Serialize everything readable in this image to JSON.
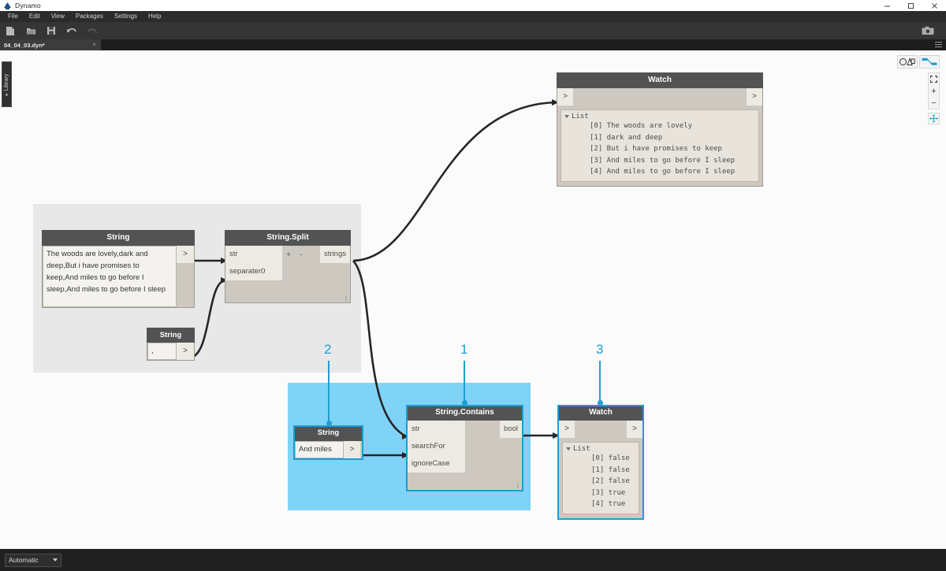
{
  "window": {
    "app_title": "Dynamo",
    "logo_icon": "dynamo-logo-icon",
    "minimize_label": "–",
    "maximize_label": "□",
    "close_label": "✕"
  },
  "menu": {
    "items": [
      {
        "label": "File"
      },
      {
        "label": "Edit"
      },
      {
        "label": "View"
      },
      {
        "label": "Packages"
      },
      {
        "label": "Settings"
      },
      {
        "label": "Help"
      }
    ]
  },
  "toolbar": {
    "buttons": [
      {
        "name": "new-file-icon"
      },
      {
        "name": "open-file-icon"
      },
      {
        "name": "save-file-icon"
      },
      {
        "name": "undo-icon"
      },
      {
        "name": "redo-icon"
      }
    ],
    "screenshot_icon": "camera-icon"
  },
  "tabs": {
    "active": {
      "label": "04_04_03.dyn*",
      "close_label": "×"
    },
    "menu_icon": "hamburger-icon"
  },
  "library": {
    "label": "Library",
    "arrow": "▸"
  },
  "canvas_controls": {
    "geometry_toggle_icon": "geometry-view-icon",
    "graph_toggle_icon": "graph-view-icon",
    "zoom_fit_label": "⤡",
    "zoom_in_label": "+",
    "zoom_out_label": "−",
    "pan_icon": "pan-icon"
  },
  "nodes": {
    "watch_top": {
      "title": "Watch",
      "in_port": ">",
      "out_port": ">",
      "list_label": "List",
      "items": [
        "[0] The woods are lovely",
        "[1] dark and deep",
        "[2] But i have promises to keep",
        "[3] And miles to go before I sleep",
        "[4] And miles to go before I sleep"
      ]
    },
    "string_main": {
      "title": "String",
      "value": "The woods are lovely,dark and deep,But i have promises to keep,And miles to go before I sleep,And miles to go before I sleep",
      "out_port": ">"
    },
    "string_split": {
      "title": "String.Split",
      "inputs": [
        "str",
        "separater0"
      ],
      "add_label": "+",
      "remove_label": "-",
      "output": "strings",
      "resize_glyph": "|"
    },
    "string_separator": {
      "title": "String",
      "value": ",",
      "out_port": ">"
    },
    "string_search": {
      "title": "String",
      "value": "And miles",
      "out_port": ">"
    },
    "string_contains": {
      "title": "String.Contains",
      "inputs": [
        "str",
        "searchFor",
        "ignoreCase"
      ],
      "output": "bool",
      "resize_glyph": "|"
    },
    "watch_bottom": {
      "title": "Watch",
      "in_port": ">",
      "out_port": ">",
      "list_label": "List",
      "items": [
        "[0] false",
        "[1] false",
        "[2] false",
        "[3] true",
        "[4] true"
      ]
    }
  },
  "annotations": [
    {
      "number": "2"
    },
    {
      "number": "1"
    },
    {
      "number": "3"
    }
  ],
  "statusbar": {
    "run_mode": "Automatic"
  },
  "colors": {
    "accent": "#1f9dd4",
    "highlight_region": "#7fd3f7",
    "node_header": "#535353",
    "node_body": "#cdc9c0",
    "port": "#edeae3",
    "canvas": "#fbfbfb",
    "group_grey": "#e8e8e8"
  }
}
